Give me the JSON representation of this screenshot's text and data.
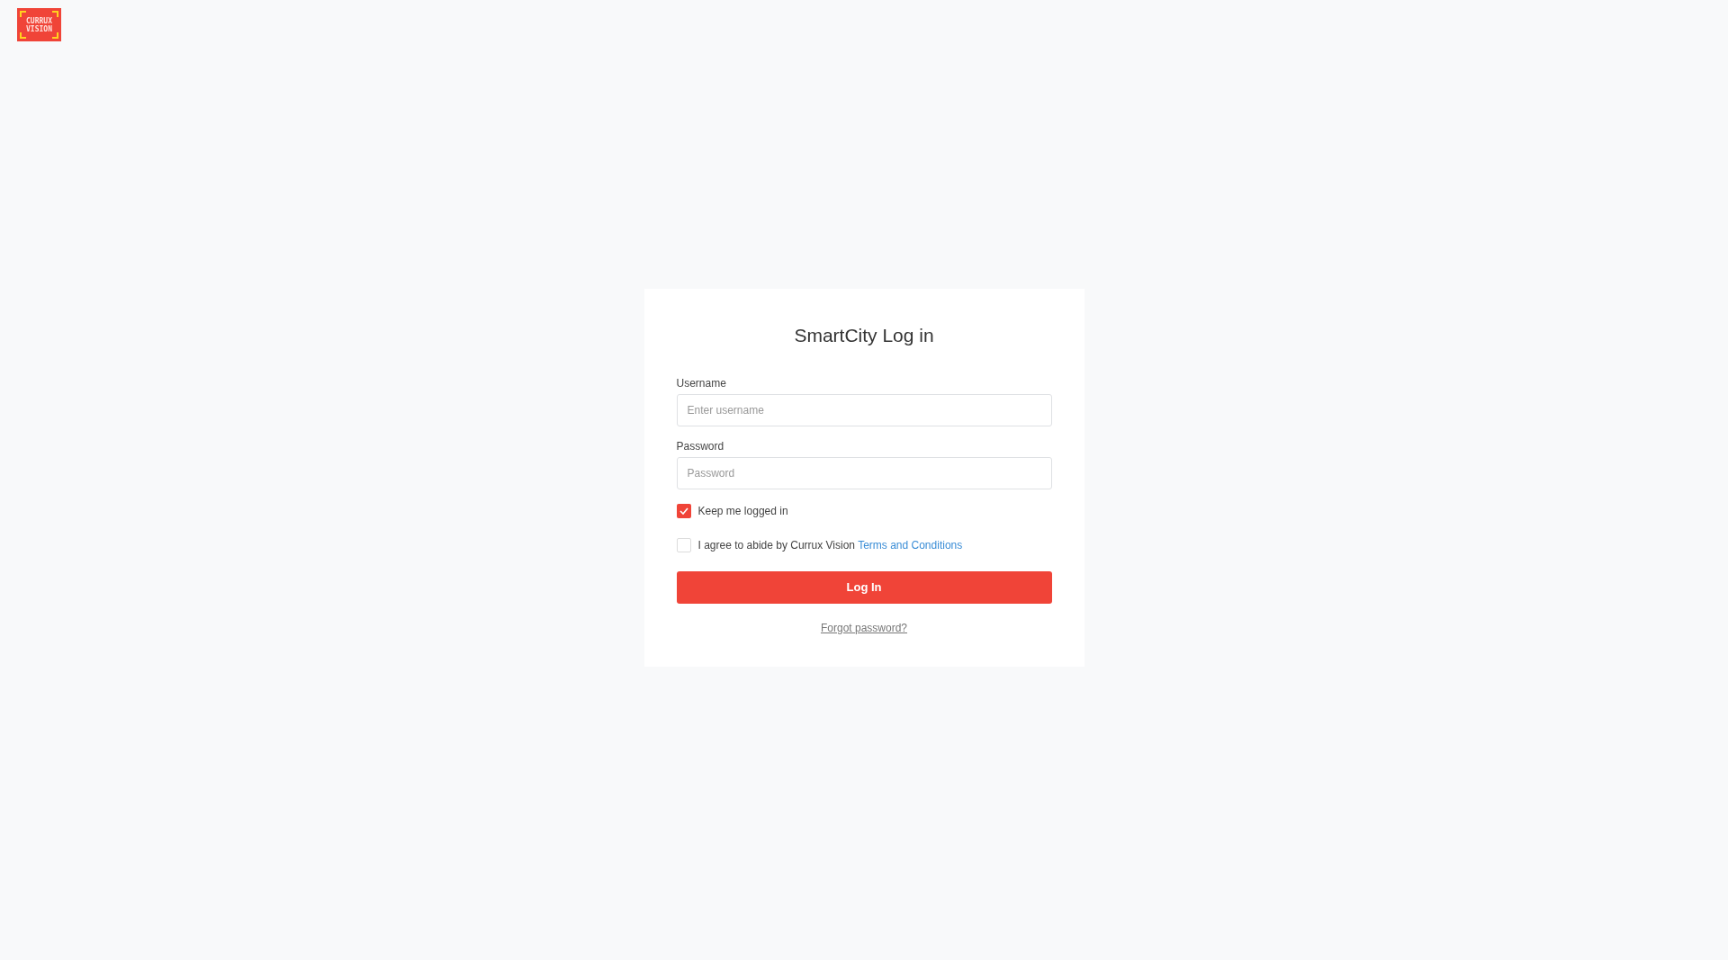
{
  "logo": {
    "lines": [
      "CURRUX",
      "VISION"
    ]
  },
  "login": {
    "title": "SmartCity Log in",
    "fields": [
      {
        "label": "Username",
        "placeholder": "Enter username"
      },
      {
        "label": "Password",
        "placeholder": "Password"
      }
    ],
    "checkboxes": [
      {
        "label": "Keep me logged in",
        "checked": true
      },
      {
        "label": "I agree to abide by Currux Vision",
        "link": "Terms and Conditions",
        "checked": false
      }
    ],
    "submit": "Log In",
    "forgot": "Forgot password?"
  }
}
